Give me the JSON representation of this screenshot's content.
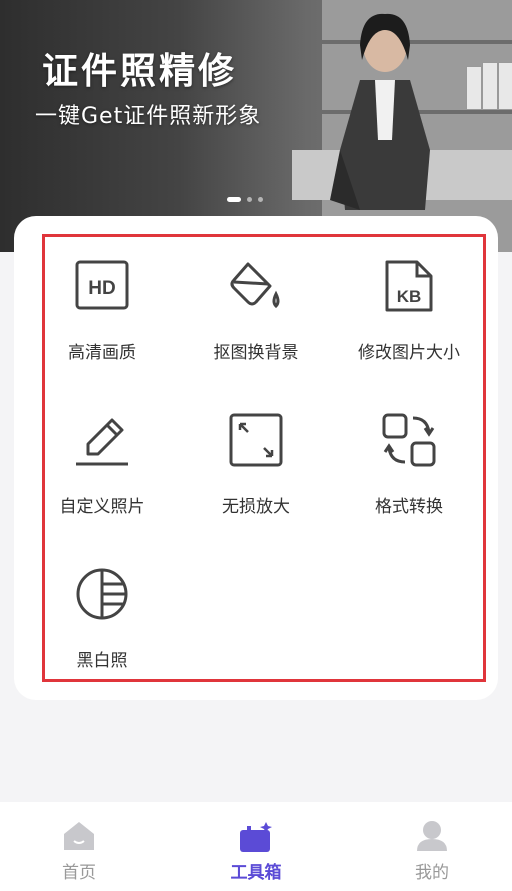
{
  "banner": {
    "title": "证件照精修",
    "subtitle": "一键Get证件照新形象"
  },
  "tools": [
    {
      "label": "高清画质",
      "icon": "hd-icon"
    },
    {
      "label": "抠图换背景",
      "icon": "paint-bucket-icon"
    },
    {
      "label": "修改图片大小",
      "icon": "kb-file-icon"
    },
    {
      "label": "自定义照片",
      "icon": "pencil-icon"
    },
    {
      "label": "无损放大",
      "icon": "expand-icon"
    },
    {
      "label": "格式转换",
      "icon": "convert-icon"
    },
    {
      "label": "黑白照",
      "icon": "black-white-icon"
    }
  ],
  "tabbar": {
    "home": "首页",
    "toolbox": "工具箱",
    "mine": "我的"
  },
  "colors": {
    "accent": "#5b4bd6",
    "highlight_border": "#e0353b",
    "inactive_icon": "#c8c8cc"
  }
}
